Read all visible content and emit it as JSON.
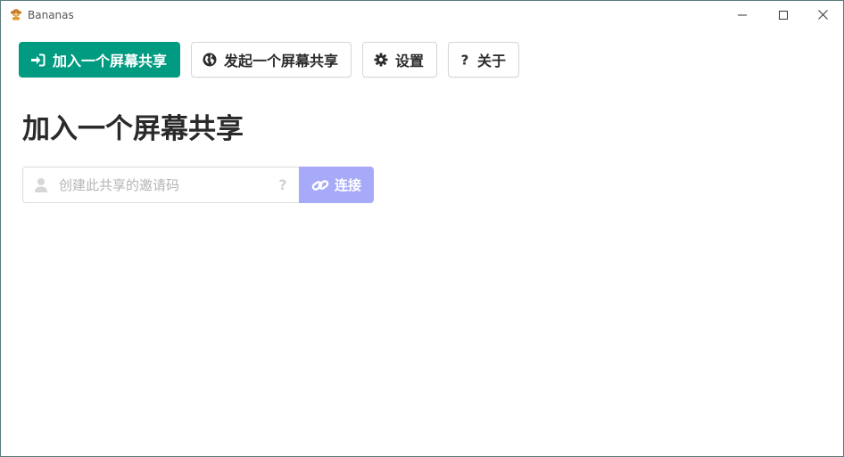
{
  "window": {
    "title": "Bananas",
    "controls": [
      "minimize-icon",
      "maximize-icon",
      "close-icon"
    ]
  },
  "toolbar": {
    "items": [
      {
        "label": "加入一个屏幕共享",
        "icon": "sign-in-icon",
        "active": true
      },
      {
        "label": "发起一个屏幕共享",
        "icon": "globe-icon",
        "active": false
      },
      {
        "label": "设置",
        "icon": "gear-icon",
        "active": false
      },
      {
        "label": "关于",
        "icon": "question-icon",
        "active": false
      }
    ]
  },
  "main": {
    "title": "加入一个屏幕共享",
    "invite": {
      "value": "",
      "placeholder": "创建此共享的邀请码",
      "user_icon": "user-icon",
      "help_icon": "question-circle-icon"
    },
    "connect_label": "连接",
    "connect_icon": "link-icon"
  },
  "colors": {
    "primary": "#009b80",
    "connect_disabled": "#a7aaf9",
    "text": "#2a2a2a",
    "border": "#d6d6d6"
  }
}
